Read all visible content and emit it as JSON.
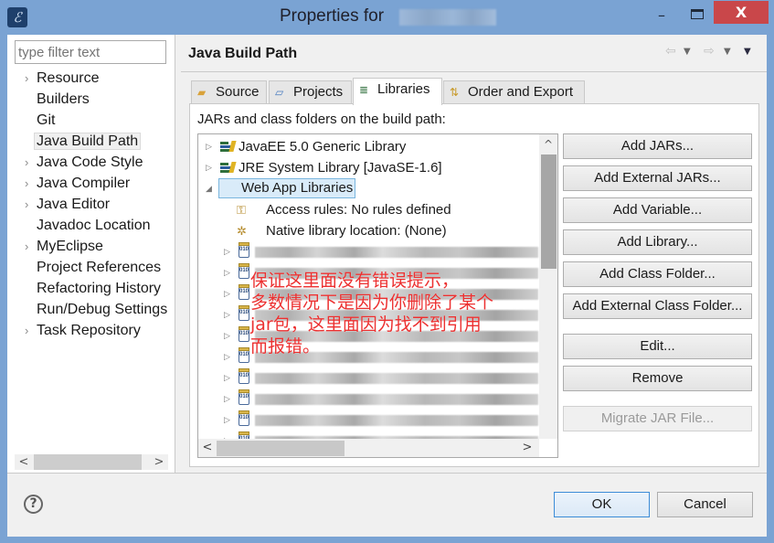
{
  "window": {
    "title": "Properties for",
    "app_icon": "eclipse-logo-icon",
    "controls": {
      "minimize": "–",
      "close": "X"
    }
  },
  "sidebar": {
    "filter_placeholder": "type filter text",
    "items": [
      {
        "label": "Resource",
        "expandable": true
      },
      {
        "label": "Builders",
        "expandable": false
      },
      {
        "label": "Git",
        "expandable": false
      },
      {
        "label": "Java Build Path",
        "expandable": false,
        "selected": true
      },
      {
        "label": "Java Code Style",
        "expandable": true
      },
      {
        "label": "Java Compiler",
        "expandable": true
      },
      {
        "label": "Java Editor",
        "expandable": true
      },
      {
        "label": "Javadoc Location",
        "expandable": false
      },
      {
        "label": "MyEclipse",
        "expandable": true
      },
      {
        "label": "Project References",
        "expandable": false
      },
      {
        "label": "Refactoring History",
        "expandable": false
      },
      {
        "label": "Run/Debug Settings",
        "expandable": false
      },
      {
        "label": "Task Repository",
        "expandable": true
      }
    ],
    "chevron": "›"
  },
  "page": {
    "title": "Java Build Path",
    "history": {
      "back": "⇦",
      "forward": "⇨",
      "dropdown": "▼"
    }
  },
  "tabs": [
    {
      "label": "Source",
      "icon": "source-folder-icon",
      "active": false
    },
    {
      "label": "Projects",
      "icon": "projects-folder-icon",
      "active": false
    },
    {
      "label": "Libraries",
      "icon": "libraries-icon",
      "active": true
    },
    {
      "label": "Order and Export",
      "icon": "order-export-icon",
      "active": false
    }
  ],
  "libraries": {
    "label": "JARs and class folders on the build path:",
    "tree": [
      {
        "label": "JavaEE 5.0 Generic Library",
        "icon": "library-icon",
        "expanded": false
      },
      {
        "label": "JRE System Library [JavaSE-1.6]",
        "icon": "library-icon",
        "expanded": false
      },
      {
        "label": "Web App Libraries",
        "icon": "library-icon",
        "expanded": true,
        "selected": true
      },
      {
        "label": "Access rules: No rules defined",
        "icon": "access-rules-icon",
        "child": true
      },
      {
        "label": "Native library location: (None)",
        "icon": "native-library-icon",
        "child": true
      }
    ],
    "jar_rows_blurred": 10,
    "jar_icon_text": "010",
    "annotation": [
      "保证这里面没有错误提示，",
      "多数情况下是因为你删除了某个",
      "jar包，这里面因为找不到引用",
      "而报错。"
    ],
    "annotation_color": "#ec3030",
    "scroll": {
      "up": "^",
      "left": "<",
      "right": ">"
    }
  },
  "buttons": [
    {
      "label": "Add JARs...",
      "enabled": true
    },
    {
      "label": "Add External JARs...",
      "enabled": true
    },
    {
      "label": "Add Variable...",
      "enabled": true
    },
    {
      "label": "Add Library...",
      "enabled": true
    },
    {
      "label": "Add Class Folder...",
      "enabled": true
    },
    {
      "label": "Add External Class Folder...",
      "enabled": true
    },
    {
      "label": "Edit...",
      "enabled": true
    },
    {
      "label": "Remove",
      "enabled": true
    },
    {
      "label": "Migrate JAR File...",
      "enabled": false
    }
  ],
  "footer": {
    "help": "?",
    "ok": "OK",
    "cancel": "Cancel"
  },
  "colors": {
    "frame": "#7aa3d3",
    "close_button": "#c9474a",
    "selection_border": "#7ab6de",
    "selection_fill": "#d9ebf9",
    "default_button_border": "#3c8cd7"
  }
}
